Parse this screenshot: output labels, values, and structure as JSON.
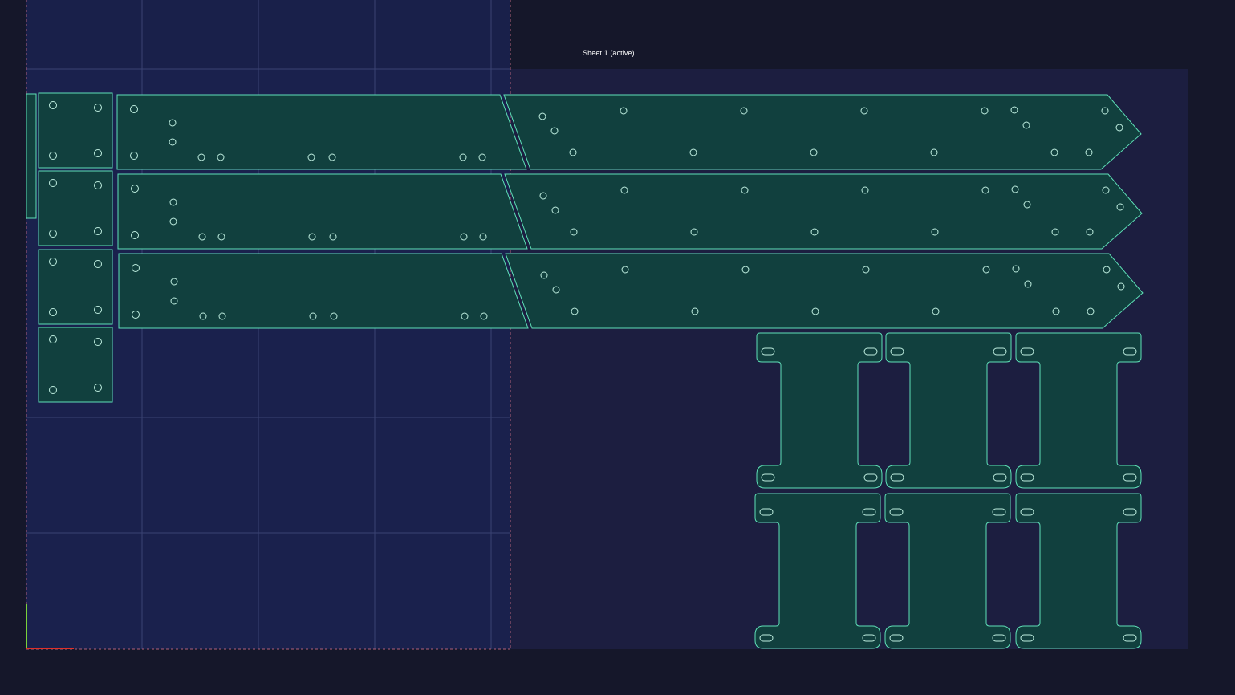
{
  "sheet": {
    "label": "Sheet 1 (active)",
    "state": "active"
  },
  "colors": {
    "background": "#15172a",
    "sheet_fill": "#1c1e40",
    "overlay_fill": "#1a2250",
    "part_fill": "#11403e",
    "part_stroke": "#5fe0b8",
    "hole_stroke": "#bfeee0",
    "grid_line": "#3a4272",
    "overlay_dash": "#b0607a",
    "axis_x": "#e0302a",
    "axis_y": "#7ad23a"
  },
  "parts": {
    "small_square_plates": 4,
    "long_beams": 3,
    "arrow_beams": 3,
    "h_brackets": 6,
    "thin_strip": 1
  }
}
